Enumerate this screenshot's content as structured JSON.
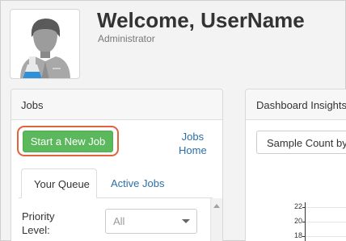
{
  "header": {
    "welcome": "Welcome, UserName",
    "role": "Administrator",
    "avatar_icon": "scientist-avatar-icon"
  },
  "jobs_panel": {
    "title": "Jobs",
    "start_button": "Start a New Job",
    "jobs_home_line1": "Jobs",
    "jobs_home_line2": "Home",
    "tabs": [
      {
        "label": "Your Queue",
        "active": true
      },
      {
        "label": "Active Jobs",
        "active": false
      }
    ],
    "priority_label_line1": "Priority",
    "priority_label_line2": "Level:",
    "priority_value": "All"
  },
  "dashboard_panel": {
    "title": "Dashboard Insights",
    "select_value": "Sample Count by",
    "y_ticks": [
      "22",
      "20",
      "18"
    ]
  },
  "colors": {
    "accent_green": "#5cb85c",
    "highlight_orange": "#e2623a",
    "link_blue": "#2a6fa8"
  }
}
